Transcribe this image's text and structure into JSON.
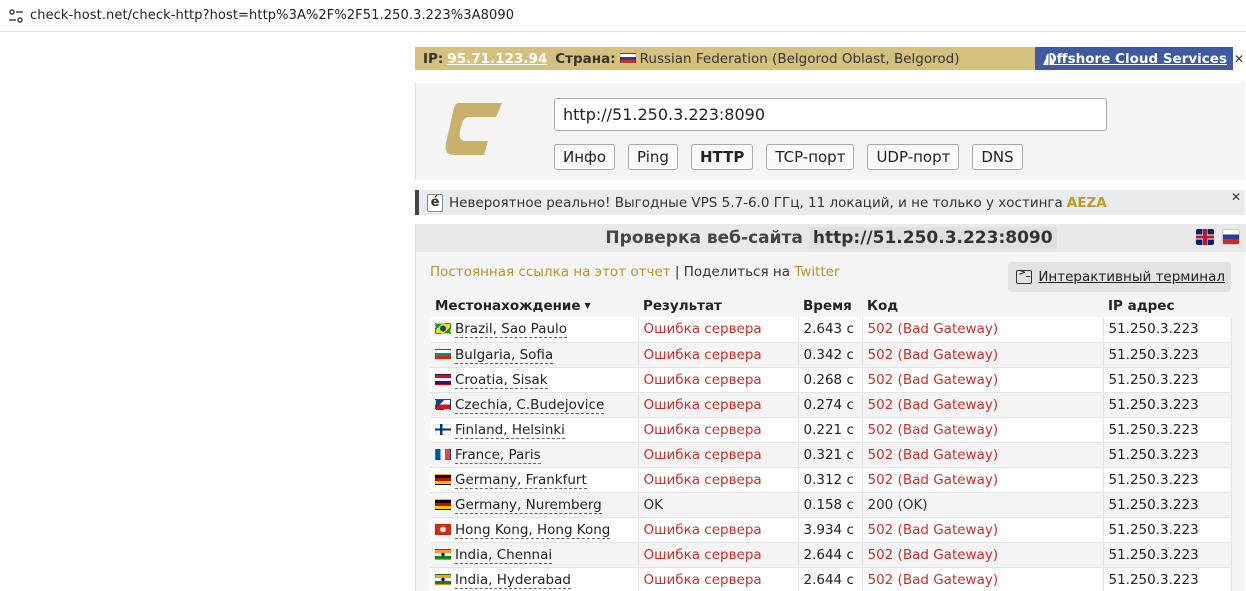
{
  "browser": {
    "url": "check-host.net/check-http?host=http%3A%2F%2F51.250.3.223%3A8090"
  },
  "ip_bar": {
    "ip_label": "IP:",
    "ip": "95.71.123.94",
    "country_label": "Страна:",
    "country": "Russian Federation (Belgorod Oblast, Belgorod)",
    "offshore_label": "Offshore Cloud Services",
    "close": "✕"
  },
  "header": {
    "url_value": "http://51.250.3.223:8090",
    "buttons": [
      "Инфо",
      "Ping",
      "HTTP",
      "TCP-порт",
      "UDP-порт",
      "DNS"
    ]
  },
  "ad": {
    "logo": "é",
    "text": "Невероятное реально! Выгодные VPS 5.7-6.0 ГГц, 11 локаций, и не только у хостинга",
    "brand": "AEZA",
    "close": "✕"
  },
  "results": {
    "title": "Проверка веб-сайта",
    "title_url": "http://51.250.3.223:8090",
    "permalink": "Постоянная ссылка на этот отчет",
    "separator": " | ",
    "share_text": "Поделиться на",
    "twitter": "Twitter",
    "terminal": "Интерактивный терминал",
    "columns": {
      "location": "Местонахождение",
      "sort_arrow": "▼",
      "result": "Результат",
      "time": "Время",
      "code": "Код",
      "ip": "IP адрес"
    },
    "rows": [
      {
        "flag": "f-br",
        "location": "Brazil, Sao Paulo",
        "result": "Ошибка сервера",
        "time": "2.643 с",
        "code": "502 (Bad Gateway)",
        "ip": "51.250.3.223",
        "status": "err"
      },
      {
        "flag": "f-bg",
        "location": "Bulgaria, Sofia",
        "result": "Ошибка сервера",
        "time": "0.342 с",
        "code": "502 (Bad Gateway)",
        "ip": "51.250.3.223",
        "status": "err"
      },
      {
        "flag": "f-hr",
        "location": "Croatia, Sisak",
        "result": "Ошибка сервера",
        "time": "0.268 с",
        "code": "502 (Bad Gateway)",
        "ip": "51.250.3.223",
        "status": "err"
      },
      {
        "flag": "f-cz",
        "location": "Czechia, C.Budejovice",
        "result": "Ошибка сервера",
        "time": "0.274 с",
        "code": "502 (Bad Gateway)",
        "ip": "51.250.3.223",
        "status": "err"
      },
      {
        "flag": "f-fi",
        "location": "Finland, Helsinki",
        "result": "Ошибка сервера",
        "time": "0.221 с",
        "code": "502 (Bad Gateway)",
        "ip": "51.250.3.223",
        "status": "err"
      },
      {
        "flag": "f-fr",
        "location": "France, Paris",
        "result": "Ошибка сервера",
        "time": "0.321 с",
        "code": "502 (Bad Gateway)",
        "ip": "51.250.3.223",
        "status": "err"
      },
      {
        "flag": "f-de",
        "location": "Germany, Frankfurt",
        "result": "Ошибка сервера",
        "time": "0.312 с",
        "code": "502 (Bad Gateway)",
        "ip": "51.250.3.223",
        "status": "err"
      },
      {
        "flag": "f-de",
        "location": "Germany, Nuremberg",
        "result": "OK",
        "time": "0.158 с",
        "code": "200 (OK)",
        "ip": "51.250.3.223",
        "status": "ok"
      },
      {
        "flag": "f-hk",
        "location": "Hong Kong, Hong Kong",
        "result": "Ошибка сервера",
        "time": "3.934 с",
        "code": "502 (Bad Gateway)",
        "ip": "51.250.3.223",
        "status": "err"
      },
      {
        "flag": "f-in",
        "location": "India, Chennai",
        "result": "Ошибка сервера",
        "time": "2.644 с",
        "code": "502 (Bad Gateway)",
        "ip": "51.250.3.223",
        "status": "err"
      },
      {
        "flag": "f-in",
        "location": "India, Hyderabad",
        "result": "Ошибка сервера",
        "time": "2.644 с",
        "code": "502 (Bad Gateway)",
        "ip": "51.250.3.223",
        "status": "err"
      }
    ]
  },
  "colors": {
    "gold": "#d6c07e",
    "link_gold": "#b79327",
    "error_red": "#c9302c",
    "offshore_blue": "#3d5aa3"
  }
}
